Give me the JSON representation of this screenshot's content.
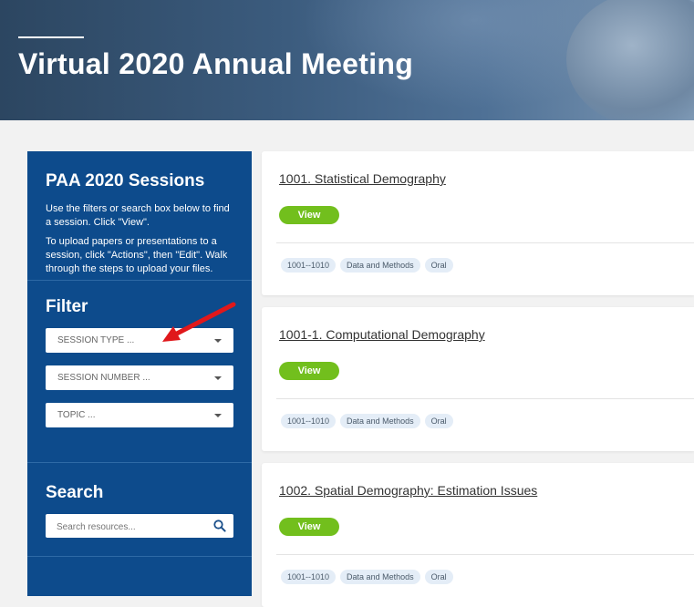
{
  "header": {
    "title": "Virtual 2020 Annual Meeting"
  },
  "sidebar": {
    "heading": "PAA 2020 Sessions",
    "intro1": "Use the filters or search box below to find a session. Click \"View\".",
    "intro2": "To upload papers or presentations to a session, click \"Actions\", then \"Edit\". Walk through the steps to upload your files.",
    "filter_heading": "Filter",
    "filters": [
      {
        "label": "SESSION TYPE ..."
      },
      {
        "label": "SESSION NUMBER ..."
      },
      {
        "label": "TOPIC ..."
      }
    ],
    "search_heading": "Search",
    "search_placeholder": "Search resources..."
  },
  "sessions": [
    {
      "title": "1001. Statistical Demography",
      "button": "View",
      "tags": [
        "1001--1010",
        "Data and Methods",
        "Oral"
      ]
    },
    {
      "title": "1001-1. Computational Demography",
      "button": "View",
      "tags": [
        "1001--1010",
        "Data and Methods",
        "Oral"
      ]
    },
    {
      "title": "1002. Spatial Demography: Estimation Issues",
      "button": "View",
      "tags": [
        "1001--1010",
        "Data and Methods",
        "Oral"
      ]
    }
  ],
  "colors": {
    "sidebar": "#0d4b8c",
    "view_button": "#72bf1d",
    "tag_bg": "#e4edf7",
    "annotation_arrow": "#e0181b"
  },
  "icons": {
    "search": "search-icon",
    "caret": "chevron-down-icon",
    "annotation": "red-arrow-icon"
  }
}
